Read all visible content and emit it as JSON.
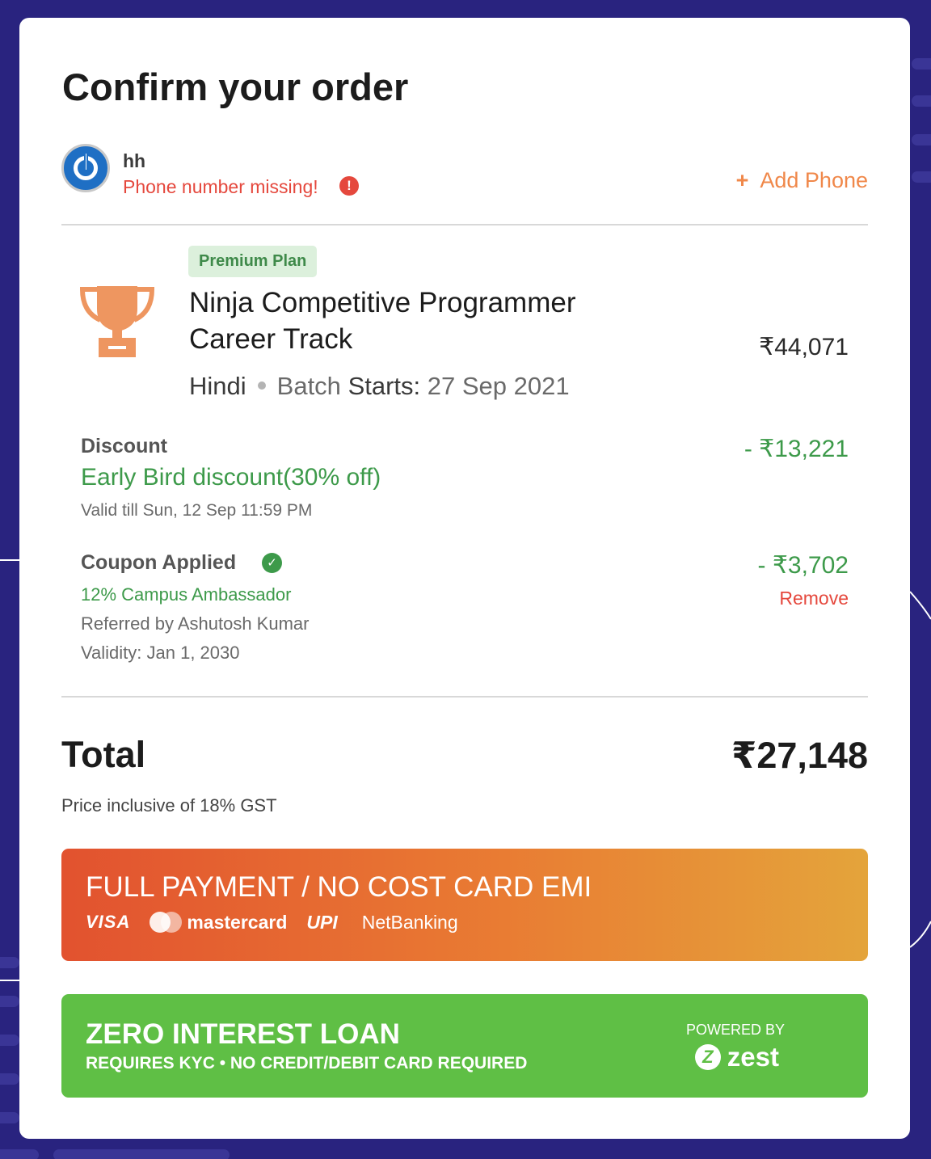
{
  "header": {
    "title": "Confirm your order"
  },
  "user": {
    "name": "hh",
    "warning": "Phone number missing!",
    "warning_icon": "!",
    "add_phone_plus": "+",
    "add_phone_label": "Add Phone"
  },
  "course": {
    "badge": "Premium Plan",
    "title": "Ninja Competitive Programmer Career Track",
    "language": "Hindi",
    "batch_label": "Batch",
    "batch_starts": "Starts:",
    "batch_date": "27 Sep 2021",
    "price": "₹44,071"
  },
  "discount": {
    "label": "Discount",
    "name": "Early Bird discount(30% off)",
    "valid": "Valid till Sun, 12 Sep 11:59 PM",
    "amount": "- ₹13,221"
  },
  "coupon": {
    "label": "Coupon Applied",
    "check_icon": "✓",
    "name": "12% Campus Ambassador",
    "referred": "Referred by Ashutosh Kumar",
    "validity": "Validity: Jan 1, 2030",
    "amount": "- ₹3,702",
    "remove_label": "Remove"
  },
  "total": {
    "label": "Total",
    "amount": "₹27,148",
    "note": "Price inclusive of 18% GST"
  },
  "full_payment": {
    "headline": "FULL PAYMENT / NO COST CARD EMI",
    "logos": {
      "visa": "VISA",
      "mastercard": "mastercard",
      "upi": "UPI",
      "netbanking": "NetBanking"
    }
  },
  "loan": {
    "headline": "ZERO INTEREST LOAN",
    "subtext": "REQUIRES KYC • NO CREDIT/DEBIT CARD REQUIRED",
    "powered_by": "POWERED BY",
    "brand": "zest",
    "brand_mark": "Z"
  },
  "colors": {
    "background": "#29237f",
    "accent_orange": "#f0884a",
    "success_green": "#3d9a4a",
    "error_red": "#e5483d",
    "loan_green": "#5fbf45"
  },
  "icons": [
    "power-icon",
    "alert-icon",
    "plus-icon",
    "trophy-icon",
    "check-circle-icon",
    "mastercard-icon",
    "zest-icon"
  ]
}
